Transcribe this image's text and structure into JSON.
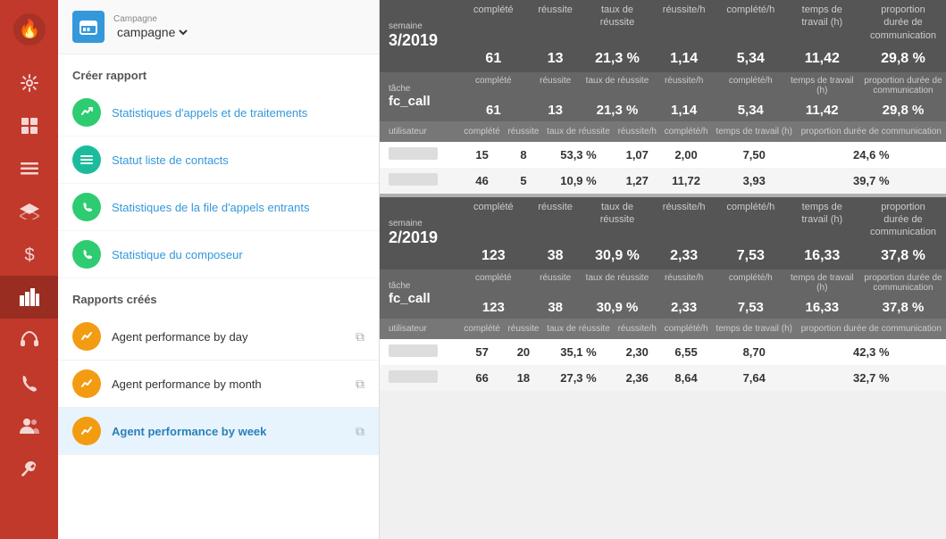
{
  "iconBar": {
    "icons": [
      "🔥",
      "💡",
      "⊞",
      "☰",
      "⬡",
      "📊",
      "💰",
      "📋",
      "🎧",
      "📞",
      "👥",
      "🔧"
    ]
  },
  "sidebar": {
    "campaignLabel": "Campagne",
    "campaignValue": "campagne",
    "createReportTitle": "Créer rapport",
    "menuItems": [
      {
        "label": "Statistiques d'appels et de traitements",
        "iconType": "green",
        "icon": "✓"
      },
      {
        "label": "Statut liste de contacts",
        "iconType": "blue-green",
        "icon": "≡"
      },
      {
        "label": "Statistiques de la file d'appels entrants",
        "iconType": "green",
        "icon": "📞"
      },
      {
        "label": "Statistique du composeur",
        "iconType": "green",
        "icon": "📞"
      }
    ],
    "createdReportsTitle": "Rapports créés",
    "reportItems": [
      {
        "label": "Agent performance by day",
        "active": false
      },
      {
        "label": "Agent performance by month",
        "active": false
      },
      {
        "label": "Agent performance by week",
        "active": true
      }
    ]
  },
  "table": {
    "headers": {
      "completed": "complété",
      "success": "réussite",
      "successRate": "taux de réussite",
      "successPerH": "réussite/h",
      "completedPerH": "complété/h",
      "workTime": "temps de travail (h)",
      "commProportion": "proportion durée de communication"
    },
    "sections": [
      {
        "weekLabel": "semaine",
        "weekValue": "3/2019",
        "completed": "61",
        "success": "13",
        "successRate": "21,3 %",
        "successPerH": "1,14",
        "completedPerH": "5,34",
        "workTime": "11,42",
        "commProportion": "29,8 %",
        "task": {
          "taskLabel": "tâche",
          "taskValue": "fc_call",
          "completed": "61",
          "success": "13",
          "successRate": "21,3 %",
          "successPerH": "1,14",
          "completedPerH": "5,34",
          "workTime": "11,42",
          "commProportion": "29,8 %"
        },
        "users": [
          {
            "name": "",
            "completed": "15",
            "success": "8",
            "successRate": "53,3 %",
            "successPerH": "1,07",
            "completedPerH": "2,00",
            "workTime": "7,50",
            "commProportion": "24,6 %"
          },
          {
            "name": "",
            "completed": "46",
            "success": "5",
            "successRate": "10,9 %",
            "successPerH": "1,27",
            "completedPerH": "11,72",
            "workTime": "3,93",
            "commProportion": "39,7 %"
          }
        ]
      },
      {
        "weekLabel": "semaine",
        "weekValue": "2/2019",
        "completed": "123",
        "success": "38",
        "successRate": "30,9 %",
        "successPerH": "2,33",
        "completedPerH": "7,53",
        "workTime": "16,33",
        "commProportion": "37,8 %",
        "task": {
          "taskLabel": "tâche",
          "taskValue": "fc_call",
          "completed": "123",
          "success": "38",
          "successRate": "30,9 %",
          "successPerH": "2,33",
          "completedPerH": "7,53",
          "workTime": "16,33",
          "commProportion": "37,8 %"
        },
        "users": [
          {
            "name": "",
            "completed": "57",
            "success": "20",
            "successRate": "35,1 %",
            "successPerH": "2,30",
            "completedPerH": "6,55",
            "workTime": "8,70",
            "commProportion": "42,3 %"
          },
          {
            "name": "",
            "completed": "66",
            "success": "18",
            "successRate": "27,3 %",
            "successPerH": "2,36",
            "completedPerH": "8,64",
            "workTime": "7,64",
            "commProportion": "32,7 %"
          }
        ]
      }
    ]
  }
}
